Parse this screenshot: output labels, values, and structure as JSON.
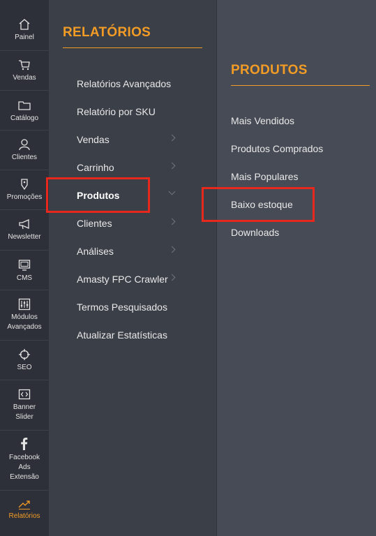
{
  "colors": {
    "accent": "#f39c25",
    "highlight": "#e8281c",
    "rail": "#2d3038",
    "panel": "#3b3f48",
    "subpanel": "#474b55"
  },
  "nav": [
    {
      "icon": "home-icon",
      "label": "Painel"
    },
    {
      "icon": "cart-icon",
      "label": "Vendas"
    },
    {
      "icon": "folder-icon",
      "label": "Catálogo"
    },
    {
      "icon": "user-icon",
      "label": "Clientes"
    },
    {
      "icon": "tag-icon",
      "label": "Promoções"
    },
    {
      "icon": "megaphone-icon",
      "label": "Newsletter"
    },
    {
      "icon": "monitor-icon",
      "label": "CMS"
    },
    {
      "icon": "sliders-icon",
      "label": "Módulos\nAvançados"
    },
    {
      "icon": "target-icon",
      "label": "SEO"
    },
    {
      "icon": "code-icon",
      "label": "Banner\nSlider"
    },
    {
      "icon": "facebook-icon",
      "label": "Facebook\nAds\nExtensão"
    },
    {
      "icon": "chart-icon",
      "label": "Relatórios"
    }
  ],
  "reports": {
    "title": "RELATÓRIOS",
    "items": [
      {
        "label": "Relatórios Avançados"
      },
      {
        "label": "Relatório por SKU"
      },
      {
        "label": "Vendas"
      },
      {
        "label": "Carrinho"
      },
      {
        "label": "Produtos"
      },
      {
        "label": "Clientes"
      },
      {
        "label": "Análises"
      },
      {
        "label": "Amasty FPC Crawler"
      },
      {
        "label": "Termos Pesquisados"
      },
      {
        "label": "Atualizar Estatísticas"
      }
    ]
  },
  "products": {
    "title": "PRODUTOS",
    "items": [
      {
        "label": "Mais Vendidos"
      },
      {
        "label": "Produtos Comprados"
      },
      {
        "label": "Mais Populares"
      },
      {
        "label": "Baixo estoque"
      },
      {
        "label": "Downloads"
      }
    ]
  }
}
